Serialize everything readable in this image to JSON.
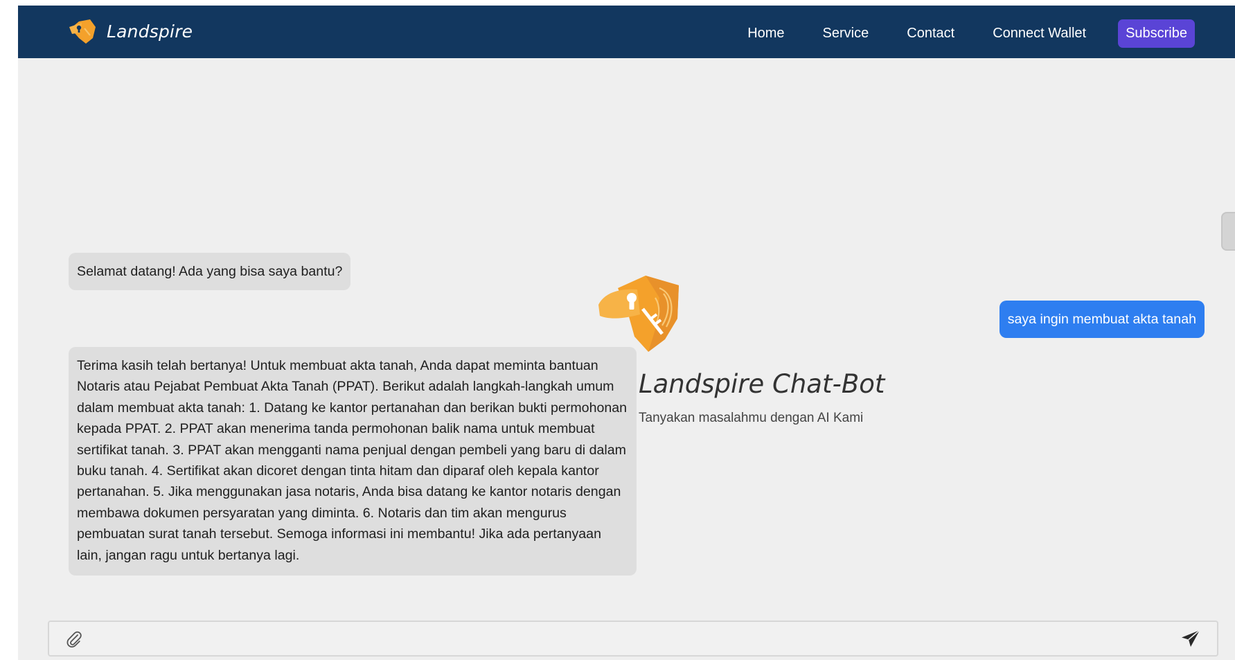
{
  "navbar": {
    "brand_name": "Landspire",
    "links": {
      "home": "Home",
      "service": "Service",
      "contact": "Contact",
      "connect_wallet": "Connect Wallet"
    },
    "subscribe_label": "Subscribe",
    "background_color": "#12375f",
    "subscribe_color": "#5a44d6"
  },
  "hero": {
    "logo_icon": "shield-key-icon",
    "title": "Landspire Chat-Bot",
    "subtitle": "Tanyakan masalahmu dengan AI Kami"
  },
  "chat": {
    "messages": [
      {
        "role": "bot",
        "text": "Selamat datang! Ada yang bisa saya bantu?"
      },
      {
        "role": "user",
        "text": "saya ingin membuat akta tanah"
      },
      {
        "role": "bot",
        "text": "Terima kasih telah bertanya! Untuk membuat akta tanah, Anda dapat meminta bantuan Notaris atau Pejabat Pembuat Akta Tanah (PPAT). Berikut adalah langkah-langkah umum dalam membuat akta tanah: 1. Datang ke kantor pertanahan dan berikan bukti permohonan kepada PPAT. 2. PPAT akan menerima tanda permohonan balik nama untuk membuat sertifikat tanah. 3. PPAT akan mengganti nama penjual dengan pembeli yang baru di dalam buku tanah. 4. Sertifikat akan dicoret dengan tinta hitam dan diparaf oleh kepala kantor pertanahan. 5. Jika menggunakan jasa notaris, Anda bisa datang ke kantor notaris dengan membawa dokumen persyaratan yang diminta. 6. Notaris dan tim akan mengurus pembuatan surat tanah tersebut. Semoga informasi ini membantu! Jika ada pertanyaan lain, jangan ragu untuk bertanya lagi."
      }
    ],
    "user_bubble_color": "#2e7ef0",
    "bot_bubble_color": "#dedede"
  },
  "composer": {
    "attach_icon": "paperclip-icon",
    "send_icon": "send-icon",
    "input_value": "",
    "input_placeholder": ""
  },
  "accent_color": "#f4a12b"
}
